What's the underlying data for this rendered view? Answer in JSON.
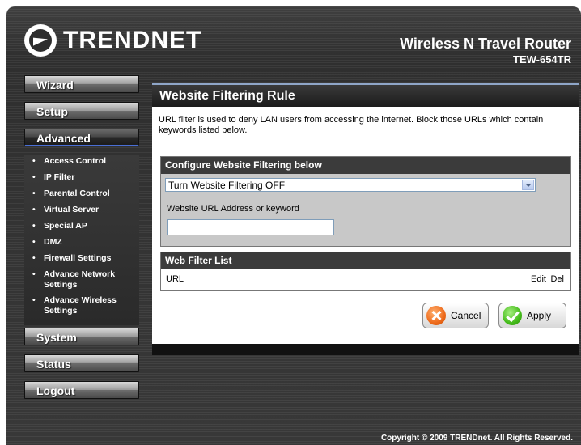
{
  "header": {
    "brand": "TRENDNET",
    "product_title": "Wireless N Travel Router",
    "model": "TEW-654TR"
  },
  "sidebar": {
    "menus": [
      {
        "label": "Wizard"
      },
      {
        "label": "Setup"
      },
      {
        "label": "Advanced"
      },
      {
        "label": "System"
      },
      {
        "label": "Status"
      },
      {
        "label": "Logout"
      }
    ],
    "submenu": [
      {
        "label": "Access Control"
      },
      {
        "label": "IP Filter"
      },
      {
        "label": "Parental Control"
      },
      {
        "label": "Virtual Server"
      },
      {
        "label": "Special AP"
      },
      {
        "label": "DMZ"
      },
      {
        "label": "Firewall Settings"
      },
      {
        "label": "Advance Network Settings"
      },
      {
        "label": "Advance Wireless Settings"
      }
    ],
    "bullet": "•"
  },
  "main": {
    "title": "Website Filtering Rule",
    "description": "URL filter is used to deny LAN users from accessing the internet. Block those URLs which contain keywords listed below.",
    "config": {
      "heading": "Configure Website Filtering below",
      "select_value": "Turn Website Filtering OFF",
      "url_label": "Website URL Address or keyword",
      "url_value": ""
    },
    "filter_list": {
      "heading": "Web Filter List",
      "col_url": "URL",
      "col_edit": "Edit",
      "col_del": "Del"
    },
    "buttons": {
      "cancel": "Cancel",
      "apply": "Apply"
    }
  },
  "footer": {
    "copyright": "Copyright © 2009 TRENDnet. All Rights Reserved."
  }
}
